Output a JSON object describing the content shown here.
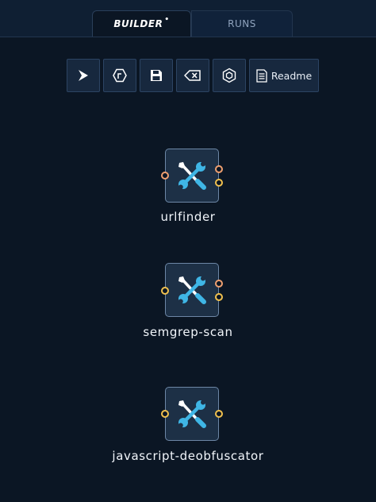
{
  "tabs": [
    {
      "label": "BUILDER",
      "modified_marker": "•",
      "active": true
    },
    {
      "label": "RUNS",
      "active": false
    }
  ],
  "toolbar": {
    "buttons": [
      {
        "icon": "play-icon"
      },
      {
        "icon": "function-icon"
      },
      {
        "icon": "save-icon"
      },
      {
        "icon": "clear-icon"
      },
      {
        "icon": "hexagon-cube-icon"
      },
      {
        "icon": "readme-document-icon",
        "label": "Readme"
      }
    ]
  },
  "nodes": [
    {
      "name": "urlfinder",
      "icon": "tools-icon",
      "inputs": [
        "orange"
      ],
      "outputs": [
        "orange",
        "yellow"
      ]
    },
    {
      "name": "semgrep-scan",
      "icon": "tools-icon",
      "inputs": [
        "yellow"
      ],
      "outputs": [
        "orange",
        "yellow"
      ]
    },
    {
      "name": "javascript-deobfuscator",
      "icon": "tools-icon",
      "inputs": [
        "yellow"
      ],
      "outputs": [
        "yellow"
      ]
    }
  ],
  "colors": {
    "background": "#0b1624",
    "icon_accent": "#3fb6e6",
    "port_orange": "#f0a070",
    "port_yellow": "#f2c14e"
  }
}
